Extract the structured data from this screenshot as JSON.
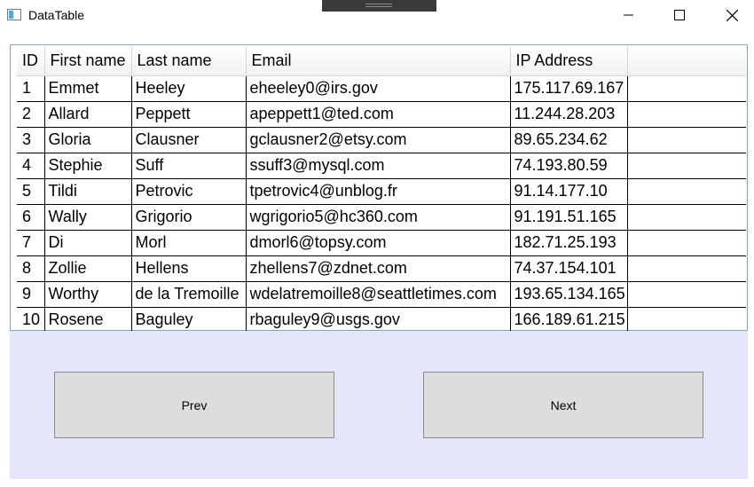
{
  "window": {
    "title": "DataTable",
    "icon": "window-app-icon",
    "controls": [
      "minimize-icon",
      "maximize-icon",
      "close-icon"
    ]
  },
  "table": {
    "columns": [
      "ID",
      "First name",
      "Last name",
      "Email",
      "IP Address"
    ],
    "rows": [
      [
        "1",
        "Emmet",
        "Heeley",
        "eheeley0@irs.gov",
        "175.117.69.167"
      ],
      [
        "2",
        "Allard",
        "Peppett",
        "apeppett1@ted.com",
        "11.244.28.203"
      ],
      [
        "3",
        "Gloria",
        "Clausner",
        "gclausner2@etsy.com",
        "89.65.234.62"
      ],
      [
        "4",
        "Stephie",
        "Suff",
        "ssuff3@mysql.com",
        "74.193.80.59"
      ],
      [
        "5",
        "Tildi",
        "Petrovic",
        "tpetrovic4@unblog.fr",
        "91.14.177.10"
      ],
      [
        "6",
        "Wally",
        "Grigorio",
        "wgrigorio5@hc360.com",
        "91.191.51.165"
      ],
      [
        "7",
        "Di",
        "Morl",
        "dmorl6@topsy.com",
        "182.71.25.193"
      ],
      [
        "8",
        "Zollie",
        "Hellens",
        "zhellens7@zdnet.com",
        "74.37.154.101"
      ],
      [
        "9",
        "Worthy",
        "de la Tremoille",
        "wdelatremoille8@seattletimes.com",
        "193.65.134.165"
      ],
      [
        "10",
        "Rosene",
        "Baguley",
        "rbaguley9@usgs.gov",
        "166.189.61.215"
      ]
    ]
  },
  "buttons": {
    "prev": "Prev",
    "next": "Next"
  },
  "colors": {
    "panel_background": "#e6e6fa",
    "button_background": "#dddddd",
    "grid_border": "#8ba2b7"
  }
}
